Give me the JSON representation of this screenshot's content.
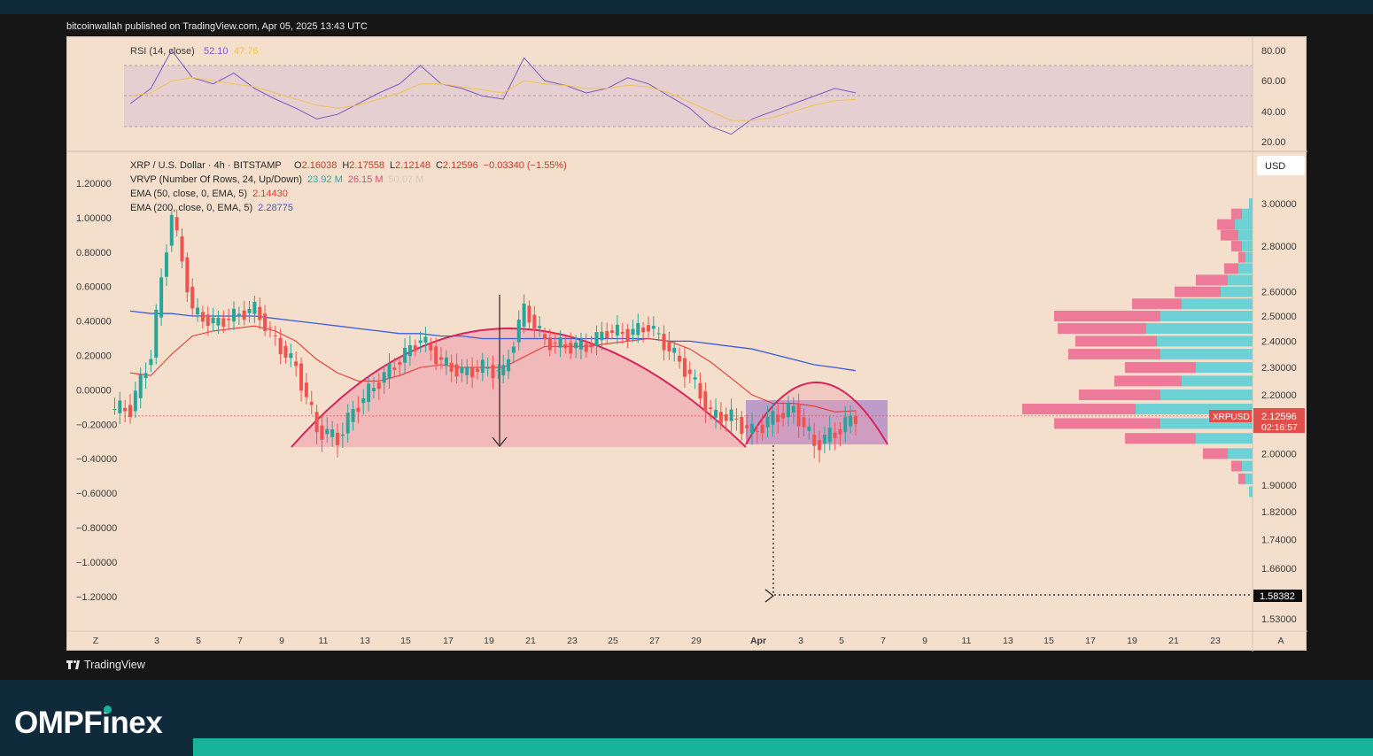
{
  "header": {
    "published": "bitcoinwallah published on TradingView.com, Apr 05, 2025 13:43 UTC"
  },
  "footer": {
    "tradingview": "TradingView",
    "brand_left": "OMPF",
    "brand_i": "i",
    "brand_right": "nex"
  },
  "rsi": {
    "label": "RSI (14, close)",
    "value": "52.10",
    "ma_value": "47.76",
    "ticks": [
      "80.00",
      "60.00",
      "40.00",
      "20.00"
    ],
    "colors": {
      "rsi": "#7e57c2",
      "ma": "#f2c14e",
      "band": "#d9bcc8"
    }
  },
  "main": {
    "legend": {
      "symbol": "XRP / U.S. Dollar · 4h · BITSTAMP",
      "o_label": "O",
      "o": "2.16038",
      "h_label": "H",
      "h": "2.17558",
      "l_label": "L",
      "l": "2.12148",
      "c_label": "C",
      "c": "2.12596",
      "change": "−0.03340 (−1.55%)",
      "vrvp": "VRVP (Number Of Rows, 24, Up/Down)",
      "vrvp_up": "23.92 M",
      "vrvp_down": "26.15 M",
      "vrvp_total": "50.07 M",
      "ema50": "EMA (50, close, 0, EMA, 5)",
      "ema50_value": "2.14430",
      "ema200": "EMA (200, close, 0, EMA, 5)",
      "ema200_value": "2.28775"
    },
    "currency": "USD",
    "symbol_tag": "XRPUSD",
    "price_tag": "2.12596",
    "countdown": "02:16:57",
    "target_tag": "1.58382",
    "left_ticks": [
      "1.20000",
      "1.00000",
      "0.80000",
      "0.60000",
      "0.40000",
      "0.20000",
      "0.00000",
      "−0.20000",
      "−0.40000",
      "−0.60000",
      "−0.80000",
      "−1.00000",
      "−1.20000"
    ],
    "right_ticks": [
      "3.00000",
      "2.80000",
      "2.60000",
      "2.50000",
      "2.40000",
      "2.30000",
      "2.20000",
      "2.00000",
      "1.90000",
      "1.82000",
      "1.74000",
      "1.66000",
      "1.53000"
    ],
    "x_ticks": [
      "Z",
      "3",
      "5",
      "7",
      "9",
      "11",
      "13",
      "15",
      "17",
      "19",
      "21",
      "23",
      "25",
      "27",
      "29",
      "Apr",
      "3",
      "5",
      "7",
      "9",
      "11",
      "13",
      "15",
      "17",
      "19",
      "21",
      "23"
    ],
    "x_corner": "A",
    "colors": {
      "up": "#26a69a",
      "down": "#ef5350",
      "ema50": "#e53935",
      "ema200": "#3f5bd8",
      "vp_up": "#5ecfd6",
      "vp_down": "#ec6f93",
      "dome": "#f1a0ad",
      "cup": "#9b6fc8",
      "price_tag": "#e0504a"
    }
  },
  "chart_data": {
    "type": "candlestick",
    "title": "XRP / U.S. Dollar · 4h · BITSTAMP",
    "y_scale": "log",
    "close_points": [
      {
        "x": "Mar 1",
        "y": 2.15
      },
      {
        "x": "Mar 2",
        "y": 2.35
      },
      {
        "x": "Mar 3",
        "y": 2.95
      },
      {
        "x": "Mar 4",
        "y": 2.52
      },
      {
        "x": "Mar 5",
        "y": 2.47
      },
      {
        "x": "Mar 6",
        "y": 2.5
      },
      {
        "x": "Mar 7",
        "y": 2.53
      },
      {
        "x": "Mar 8",
        "y": 2.4
      },
      {
        "x": "Mar 9",
        "y": 2.3
      },
      {
        "x": "Mar 10",
        "y": 2.08
      },
      {
        "x": "Mar 11",
        "y": 2.05
      },
      {
        "x": "Mar 12",
        "y": 2.17
      },
      {
        "x": "Mar 13",
        "y": 2.25
      },
      {
        "x": "Mar 14",
        "y": 2.33
      },
      {
        "x": "Mar 15",
        "y": 2.41
      },
      {
        "x": "Mar 16",
        "y": 2.32
      },
      {
        "x": "Mar 17",
        "y": 2.28
      },
      {
        "x": "Mar 18",
        "y": 2.3
      },
      {
        "x": "Mar 19",
        "y": 2.28
      },
      {
        "x": "Mar 20",
        "y": 2.53
      },
      {
        "x": "Mar 21",
        "y": 2.4
      },
      {
        "x": "Mar 22",
        "y": 2.38
      },
      {
        "x": "Mar 23",
        "y": 2.38
      },
      {
        "x": "Mar 24",
        "y": 2.44
      },
      {
        "x": "Mar 25",
        "y": 2.43
      },
      {
        "x": "Mar 26",
        "y": 2.46
      },
      {
        "x": "Mar 27",
        "y": 2.37
      },
      {
        "x": "Mar 28",
        "y": 2.27
      },
      {
        "x": "Mar 29",
        "y": 2.13
      },
      {
        "x": "Mar 30",
        "y": 2.12
      },
      {
        "x": "Mar 31",
        "y": 2.07
      },
      {
        "x": "Apr 1",
        "y": 2.12
      },
      {
        "x": "Apr 2",
        "y": 2.15
      },
      {
        "x": "Apr 3",
        "y": 2.03
      },
      {
        "x": "Apr 4",
        "y": 2.07
      },
      {
        "x": "Apr 5",
        "y": 2.126
      }
    ],
    "ema50": [
      2.28,
      2.27,
      2.35,
      2.42,
      2.44,
      2.45,
      2.46,
      2.44,
      2.4,
      2.33,
      2.28,
      2.25,
      2.25,
      2.27,
      2.3,
      2.31,
      2.3,
      2.3,
      2.3,
      2.34,
      2.38,
      2.38,
      2.38,
      2.39,
      2.4,
      2.41,
      2.4,
      2.37,
      2.32,
      2.26,
      2.2,
      2.17,
      2.17,
      2.16,
      2.14,
      2.144
    ],
    "ema200": [
      2.52,
      2.51,
      2.51,
      2.5,
      2.5,
      2.5,
      2.5,
      2.49,
      2.48,
      2.47,
      2.46,
      2.45,
      2.44,
      2.43,
      2.43,
      2.42,
      2.42,
      2.41,
      2.41,
      2.41,
      2.41,
      2.41,
      2.41,
      2.41,
      2.41,
      2.41,
      2.4,
      2.4,
      2.39,
      2.38,
      2.37,
      2.35,
      2.33,
      2.31,
      2.3,
      2.288
    ],
    "volume_profile": [
      {
        "price": 3.0,
        "up": 0.1,
        "down": 0.0
      },
      {
        "price": 2.95,
        "up": 0.3,
        "down": 0.3
      },
      {
        "price": 2.9,
        "up": 0.5,
        "down": 0.5
      },
      {
        "price": 2.85,
        "up": 0.4,
        "down": 0.5
      },
      {
        "price": 2.8,
        "up": 0.3,
        "down": 0.3
      },
      {
        "price": 2.75,
        "up": 0.2,
        "down": 0.2
      },
      {
        "price": 2.7,
        "up": 0.4,
        "down": 0.4
      },
      {
        "price": 2.65,
        "up": 0.7,
        "down": 0.9
      },
      {
        "price": 2.6,
        "up": 0.9,
        "down": 1.3
      },
      {
        "price": 2.55,
        "up": 2.0,
        "down": 1.4
      },
      {
        "price": 2.5,
        "up": 2.6,
        "down": 3.0
      },
      {
        "price": 2.45,
        "up": 3.0,
        "down": 2.5
      },
      {
        "price": 2.4,
        "up": 2.7,
        "down": 2.3
      },
      {
        "price": 2.35,
        "up": 2.6,
        "down": 2.6
      },
      {
        "price": 2.3,
        "up": 1.6,
        "down": 2.0
      },
      {
        "price": 2.25,
        "up": 2.0,
        "down": 1.9
      },
      {
        "price": 2.2,
        "up": 2.6,
        "down": 2.3
      },
      {
        "price": 2.15,
        "up": 3.3,
        "down": 3.2
      },
      {
        "price": 2.1,
        "up": 2.6,
        "down": 3.0
      },
      {
        "price": 2.05,
        "up": 1.6,
        "down": 2.0
      },
      {
        "price": 2.0,
        "up": 0.7,
        "down": 0.7
      },
      {
        "price": 1.96,
        "up": 0.3,
        "down": 0.3
      },
      {
        "price": 1.92,
        "up": 0.2,
        "down": 0.2
      },
      {
        "price": 1.88,
        "up": 0.1,
        "down": 0.0
      }
    ],
    "levels": {
      "current_price": 2.12596,
      "target": 1.58382
    },
    "rsi_points": [
      45,
      55,
      80,
      62,
      58,
      65,
      55,
      48,
      42,
      35,
      38,
      45,
      52,
      58,
      70,
      58,
      55,
      50,
      48,
      75,
      60,
      57,
      52,
      55,
      62,
      58,
      50,
      42,
      30,
      25,
      35,
      40,
      45,
      50,
      55,
      52.1
    ],
    "rsi_ma_points": [
      50,
      52,
      60,
      62,
      60,
      58,
      56,
      52,
      48,
      44,
      42,
      44,
      48,
      52,
      58,
      58,
      56,
      54,
      52,
      60,
      58,
      57,
      55,
      55,
      57,
      56,
      52,
      46,
      40,
      34,
      34,
      36,
      40,
      44,
      47,
      47.76
    ]
  }
}
